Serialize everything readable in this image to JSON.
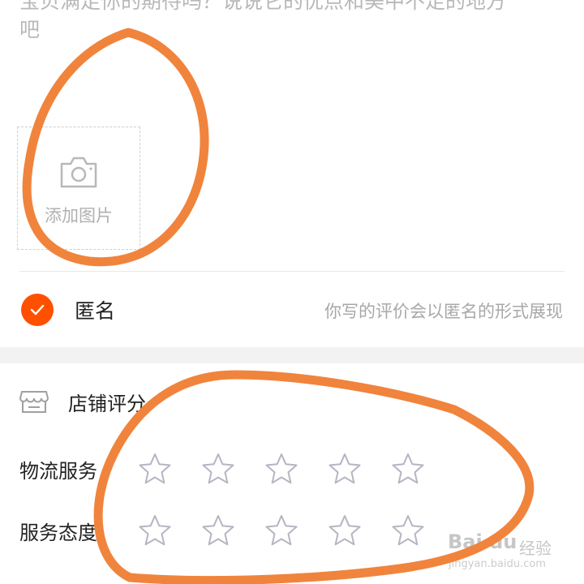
{
  "review": {
    "prompt_text": "宝贝满足你的期待吗？说说它的优点和美中不足的地方\n吧"
  },
  "add_photo": {
    "label": "添加图片",
    "icon": "camera-icon"
  },
  "anonymous": {
    "checked": true,
    "label": "匿名",
    "hint": "你写的评价会以匿名的形式展现",
    "accent_color": "#ff5000"
  },
  "shop_rating": {
    "title": "店铺评分",
    "icon": "storefront-icon",
    "items": [
      {
        "name": "物流服务",
        "rating": 0,
        "max": 5
      },
      {
        "name": "服务态度",
        "rating": 0,
        "max": 5
      }
    ]
  },
  "watermark": {
    "brand": "Bai du",
    "suffix": "经验",
    "url": "jingyan.baidu.com"
  },
  "annotation_color": "#f0843c"
}
